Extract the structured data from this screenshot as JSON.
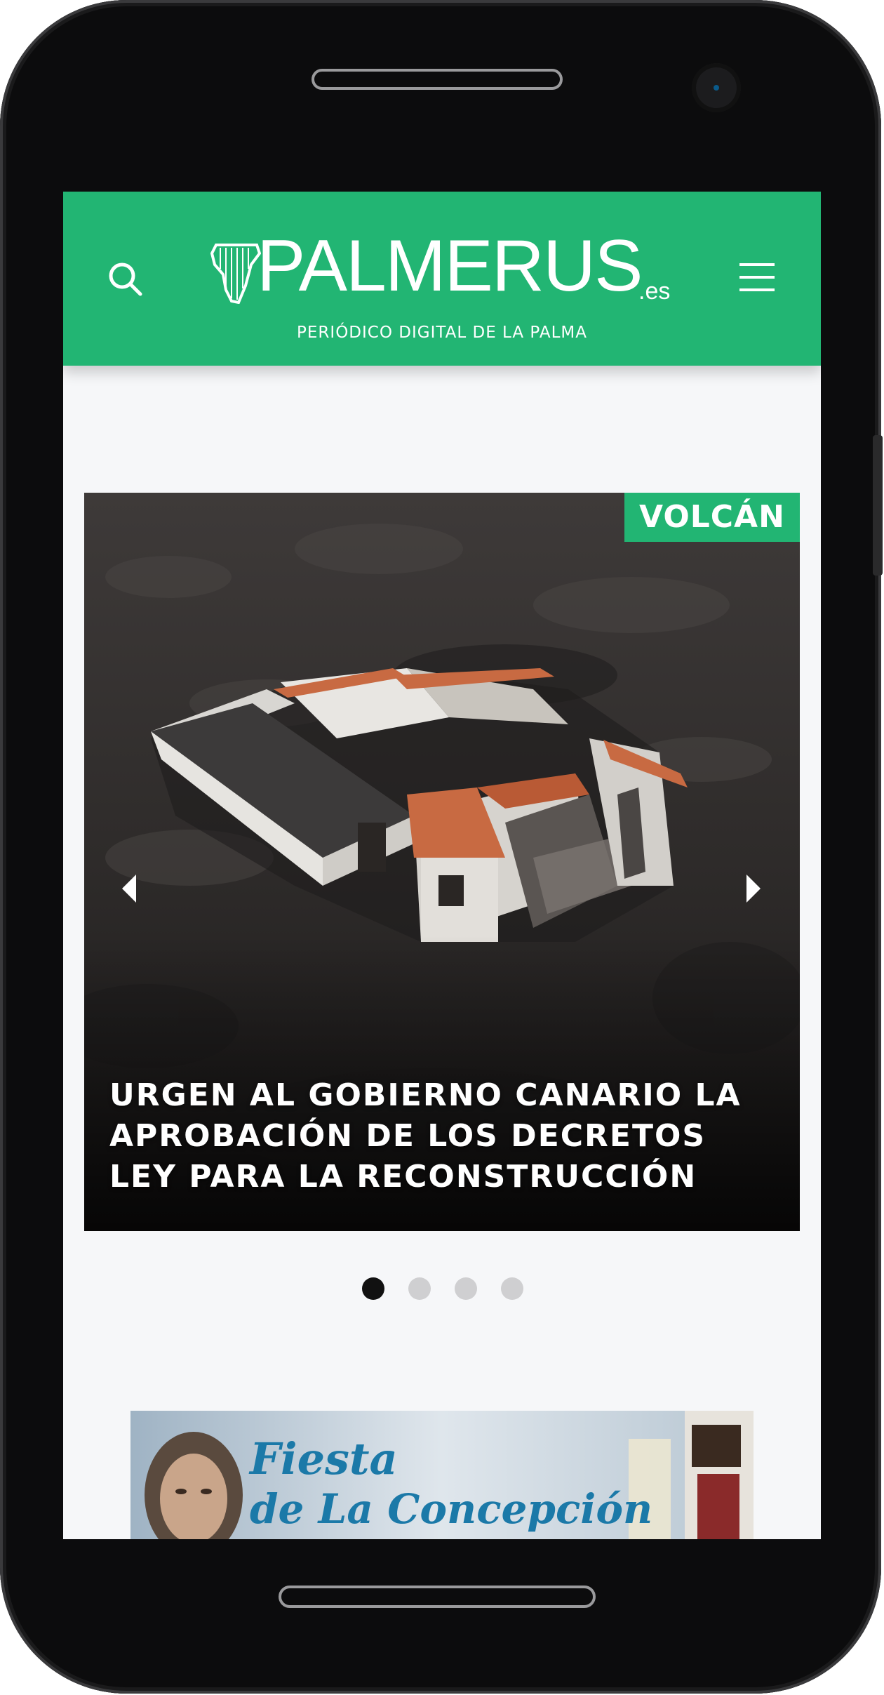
{
  "header": {
    "logo_text": "PALMERUS",
    "logo_suffix": ".es",
    "tagline": "PERIÓDICO DIGITAL DE LA PALMA"
  },
  "slider": {
    "category": "VOLCÁN",
    "headline": "URGEN AL GOBIERNO CANARIO LA APROBACIÓN DE LOS DECRETOS LEY PARA LA RECONSTRUCCIÓN",
    "dots_count": 4,
    "active_dot": 1
  },
  "ad": {
    "line1": "Fiesta",
    "line2": "de La Concepción"
  },
  "colors": {
    "brand_green": "#22b573",
    "page_bg": "#f6f7f9",
    "phone_frame": "#0c0c0d"
  },
  "icons": [
    "search-icon",
    "hamburger-menu-icon",
    "la-palma-map-icon",
    "chevron-left-icon",
    "chevron-right-icon"
  ]
}
